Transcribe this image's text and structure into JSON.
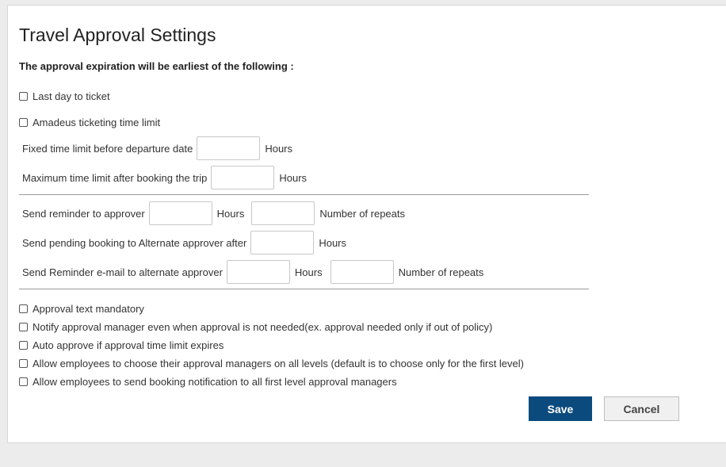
{
  "page": {
    "title": "Travel Approval Settings",
    "subtitle": "The approval expiration will be earliest of the following :"
  },
  "expiration": {
    "last_day_to_ticket": "Last day to ticket",
    "amadeus_time_limit": "Amadeus ticketing time limit",
    "fixed_limit_label": "Fixed time limit before departure date",
    "fixed_limit_unit": "Hours",
    "fixed_limit_value": "",
    "max_limit_label": "Maximum time limit after booking the trip",
    "max_limit_unit": "Hours",
    "max_limit_value": ""
  },
  "reminders": {
    "send_reminder_label": "Send reminder to approver",
    "send_reminder_unit": "Hours",
    "send_reminder_hours": "",
    "send_reminder_repeats": "",
    "send_reminder_repeats_label": "Number of repeats",
    "pending_alt_label": "Send pending booking to Alternate approver after",
    "pending_alt_unit": "Hours",
    "pending_alt_value": "",
    "alt_email_label": "Send Reminder e-mail to alternate approver",
    "alt_email_unit": "Hours",
    "alt_email_hours": "",
    "alt_email_repeats": "",
    "alt_email_repeats_label": "Number of repeats"
  },
  "options": [
    {
      "label": "Approval text mandatory",
      "checked": false
    },
    {
      "label": "Notify approval manager even when approval is not needed(ex. approval needed only if out of policy)",
      "checked": false
    },
    {
      "label": "Auto approve if approval time limit expires",
      "checked": false
    },
    {
      "label": "Allow employees to choose their approval managers on all levels (default is to choose only for the first level)",
      "checked": false
    },
    {
      "label": "Allow employees to send booking notification to all first level approval managers",
      "checked": false
    }
  ],
  "actions": {
    "save": "Save",
    "cancel": "Cancel"
  },
  "colors": {
    "primary": "#0b4a7d",
    "background": "#ececec"
  }
}
